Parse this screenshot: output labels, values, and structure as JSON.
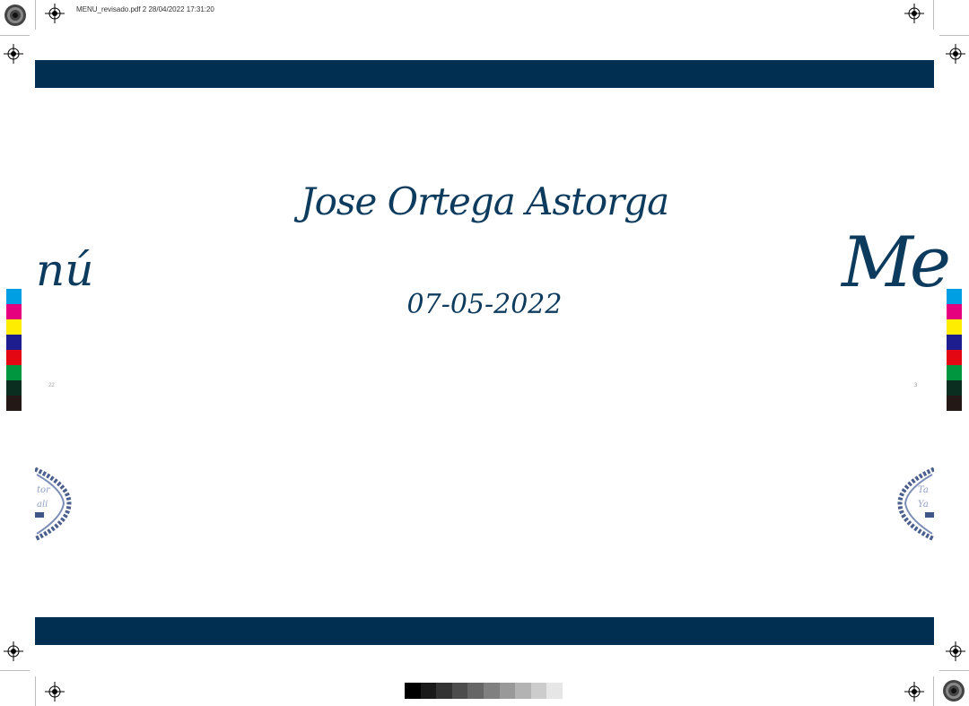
{
  "header": {
    "slug_text": "MENU_revisado.pdf  2  28/04/2022  17:31:20"
  },
  "page": {
    "name": "Jose Ortega Astorga",
    "date": "07-05-2022",
    "split_word_left": "nú",
    "split_word_right": "Me",
    "page_number_left": "22",
    "page_number_right": "3"
  },
  "colors": {
    "brand_navy": "#002f52",
    "script_text": "#0d3b5e",
    "color_bar": [
      "#009fe3",
      "#e6007e",
      "#ffed00",
      "#1d1d8f",
      "#e30613",
      "#00963f",
      "#0a2e1f",
      "#231815"
    ],
    "gray_ramp": [
      "#000000",
      "#1a1a1a",
      "#333333",
      "#4d4d4d",
      "#666666",
      "#808080",
      "#999999",
      "#b3b3b3",
      "#cccccc",
      "#e6e6e6"
    ]
  }
}
